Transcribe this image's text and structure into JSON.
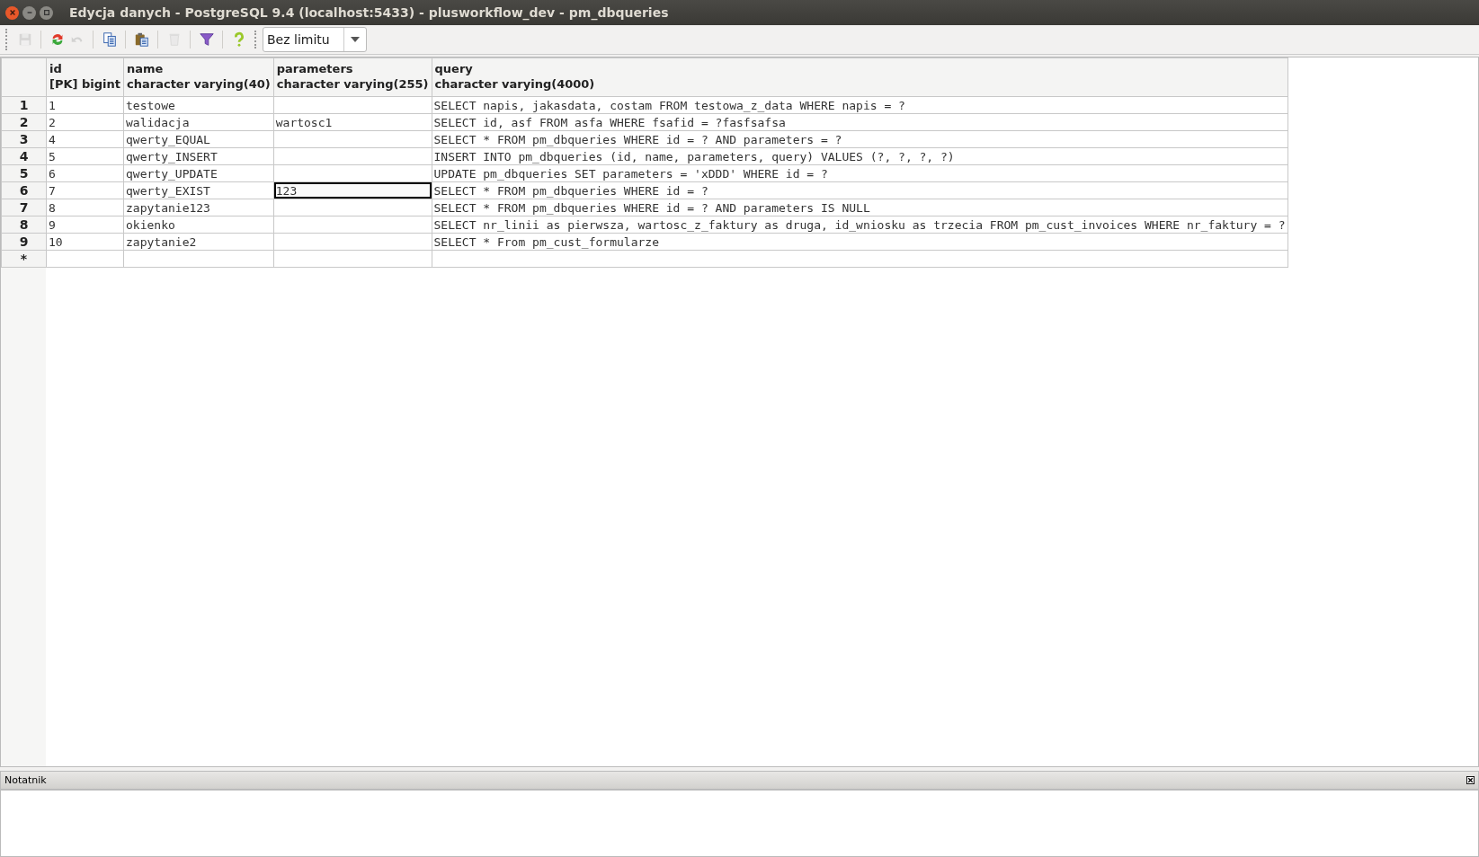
{
  "window": {
    "title": "Edycja danych - PostgreSQL 9.4 (localhost:5433) - plusworkflow_dev - pm_dbqueries"
  },
  "toolbar": {
    "buttons": [
      {
        "kind": "save",
        "disabled": true
      },
      {
        "kind": "refresh",
        "disabled": false
      },
      {
        "kind": "undo",
        "disabled": true
      },
      {
        "kind": "copy",
        "disabled": false
      },
      {
        "kind": "paste",
        "disabled": false
      },
      {
        "kind": "delete",
        "disabled": true
      },
      {
        "kind": "filter",
        "disabled": false
      },
      {
        "kind": "help",
        "disabled": false
      }
    ],
    "limit_dropdown": {
      "value": "Bez limitu"
    }
  },
  "table": {
    "columns": [
      {
        "name": "id",
        "type": "[PK] bigint"
      },
      {
        "name": "name",
        "type": "character varying(40)"
      },
      {
        "name": "parameters",
        "type": "character varying(255)"
      },
      {
        "name": "query",
        "type": "character varying(4000)"
      }
    ],
    "rows": [
      {
        "number": "1",
        "cells": [
          {
            "text": "1",
            "selected": false
          },
          {
            "text": "testowe",
            "selected": false
          },
          {
            "selected": false
          },
          {
            "text": "SELECT napis, jakasdata, costam FROM testowa_z_data WHERE napis = ?",
            "selected": false
          }
        ]
      },
      {
        "number": "2",
        "cells": [
          {
            "text": "2",
            "selected": false
          },
          {
            "text": "walidacja",
            "selected": false
          },
          {
            "text": "wartosc1",
            "selected": false
          },
          {
            "text": "SELECT id, asf FROM asfa WHERE fsafid = ?fasfsafsa",
            "selected": false
          }
        ]
      },
      {
        "number": "3",
        "cells": [
          {
            "text": "4",
            "selected": false
          },
          {
            "text": "qwerty_EQUAL",
            "selected": false
          },
          {
            "selected": false
          },
          {
            "text": "SELECT * FROM pm_dbqueries WHERE id = ? AND parameters = ?",
            "selected": false
          }
        ]
      },
      {
        "number": "4",
        "cells": [
          {
            "text": "5",
            "selected": false
          },
          {
            "text": "qwerty_INSERT",
            "selected": false
          },
          {
            "selected": false
          },
          {
            "text": "INSERT INTO pm_dbqueries (id, name, parameters, query) VALUES (?, ?, ?, ?)",
            "selected": false
          }
        ]
      },
      {
        "number": "5",
        "cells": [
          {
            "text": "6",
            "selected": false
          },
          {
            "text": "qwerty_UPDATE",
            "selected": false
          },
          {
            "selected": false
          },
          {
            "text": "UPDATE pm_dbqueries SET parameters = 'xDDD' WHERE id = ?",
            "selected": false
          }
        ]
      },
      {
        "number": "6",
        "cells": [
          {
            "text": "7",
            "selected": false
          },
          {
            "text": "qwerty_EXIST",
            "selected": false
          },
          {
            "text": "123",
            "selected": true
          },
          {
            "text": "SELECT * FROM pm_dbqueries WHERE id = ?",
            "selected": false
          }
        ]
      },
      {
        "number": "7",
        "cells": [
          {
            "text": "8",
            "selected": false
          },
          {
            "text": "zapytanie123",
            "selected": false
          },
          {
            "selected": false
          },
          {
            "text": "SELECT * FROM pm_dbqueries WHERE id = ? AND parameters IS NULL",
            "selected": false
          }
        ]
      },
      {
        "number": "8",
        "cells": [
          {
            "text": "9",
            "selected": false
          },
          {
            "text": "okienko",
            "selected": false
          },
          {
            "selected": false
          },
          {
            "text": "SELECT nr_linii as pierwsza, wartosc_z_faktury as druga, id_wniosku as trzecia FROM pm_cust_invoices WHERE nr_faktury = ?",
            "selected": false
          }
        ]
      },
      {
        "number": "9",
        "cells": [
          {
            "text": "10",
            "selected": false
          },
          {
            "text": "zapytanie2",
            "selected": false
          },
          {
            "selected": false
          },
          {
            "text": "SELECT * From pm_cust_formularze",
            "selected": false
          }
        ]
      },
      {
        "number": "*",
        "cells": [
          {
            "selected": false
          },
          {
            "selected": false
          },
          {
            "selected": false
          },
          {
            "selected": false
          }
        ]
      }
    ]
  },
  "notepad": {
    "title": "Notatnik"
  }
}
